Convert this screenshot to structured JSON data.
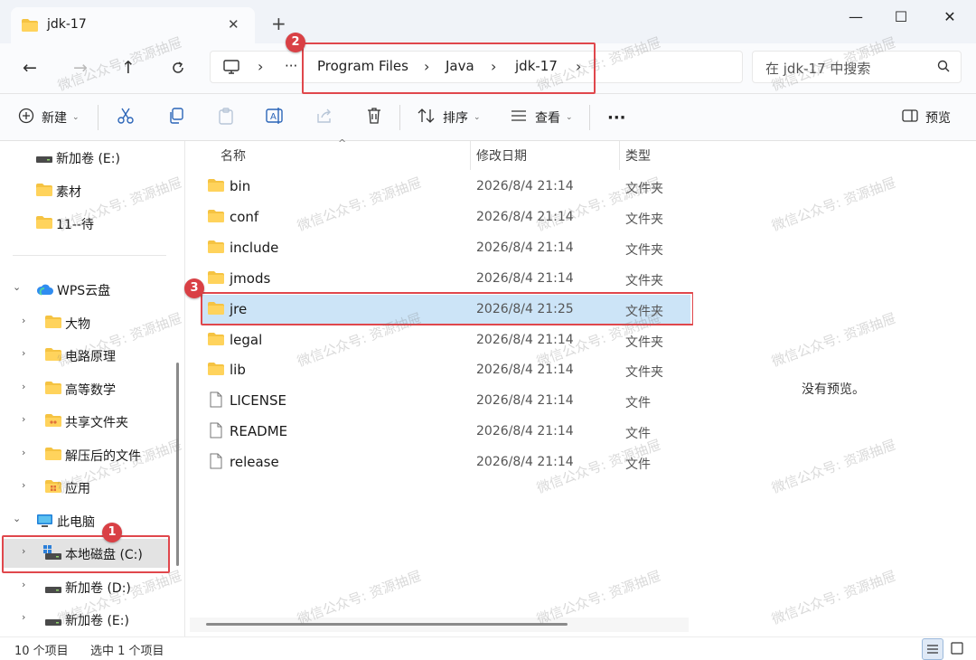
{
  "window": {
    "tab_title": "jdk-17",
    "new_tab_symbol": "+",
    "minimize_symbol": "—",
    "maximize_symbol": "☐",
    "close_symbol": "✕"
  },
  "nav": {
    "ellipsis": "···",
    "breadcrumbs": [
      "Program Files",
      "Java",
      "jdk-17"
    ],
    "search_placeholder": "在 jdk-17 中搜索"
  },
  "toolbar": {
    "new_label": "新建",
    "sort_label": "排序",
    "view_label": "查看",
    "more_label": "···",
    "preview_label": "预览"
  },
  "sidebar": {
    "items": [
      {
        "label": "新加卷 (E:)",
        "icon": "drive-icon"
      },
      {
        "label": "素材",
        "icon": "folder-icon"
      },
      {
        "label": "11--待",
        "icon": "folder-icon"
      },
      {
        "label": "WPS云盘",
        "icon": "cloud-icon"
      },
      {
        "label": "大物",
        "icon": "folder-icon"
      },
      {
        "label": "电路原理",
        "icon": "folder-icon"
      },
      {
        "label": "高等数学",
        "icon": "folder-icon"
      },
      {
        "label": "共享文件夹",
        "icon": "shared-folder-icon"
      },
      {
        "label": "解压后的文件",
        "icon": "folder-icon"
      },
      {
        "label": "应用",
        "icon": "apps-folder-icon"
      },
      {
        "label": "此电脑",
        "icon": "pc-icon"
      },
      {
        "label": "本地磁盘 (C:)",
        "icon": "windows-drive-icon"
      },
      {
        "label": "新加卷 (D:)",
        "icon": "drive-icon"
      },
      {
        "label": "新加卷 (E:)",
        "icon": "drive-icon"
      }
    ]
  },
  "columns": {
    "name": "名称",
    "date": "修改日期",
    "type": "类型"
  },
  "files": [
    {
      "name": "bin",
      "date": "2026/8/4 21:14",
      "type": "文件夹",
      "kind": "folder"
    },
    {
      "name": "conf",
      "date": "2026/8/4 21:14",
      "type": "文件夹",
      "kind": "folder"
    },
    {
      "name": "include",
      "date": "2026/8/4 21:14",
      "type": "文件夹",
      "kind": "folder"
    },
    {
      "name": "jmods",
      "date": "2026/8/4 21:14",
      "type": "文件夹",
      "kind": "folder"
    },
    {
      "name": "jre",
      "date": "2026/8/4 21:25",
      "type": "文件夹",
      "kind": "folder"
    },
    {
      "name": "legal",
      "date": "2026/8/4 21:14",
      "type": "文件夹",
      "kind": "folder"
    },
    {
      "name": "lib",
      "date": "2026/8/4 21:14",
      "type": "文件夹",
      "kind": "folder"
    },
    {
      "name": "LICENSE",
      "date": "2026/8/4 21:14",
      "type": "文件",
      "kind": "file"
    },
    {
      "name": "README",
      "date": "2026/8/4 21:14",
      "type": "文件",
      "kind": "file"
    },
    {
      "name": "release",
      "date": "2026/8/4 21:14",
      "type": "文件",
      "kind": "file"
    }
  ],
  "preview": {
    "message": "没有预览。"
  },
  "status": {
    "item_count": "10 个项目",
    "selected": "选中 1 个项目"
  },
  "annotations": {
    "badge_1": "1",
    "badge_2": "2",
    "badge_3": "3",
    "highlight_color": "#e0474c"
  },
  "watermark": {
    "text": "微信公众号: 资源抽屉"
  },
  "colors": {
    "folder": "#f5c342",
    "selection": "#cce4f7",
    "accent": "#0067c0"
  }
}
